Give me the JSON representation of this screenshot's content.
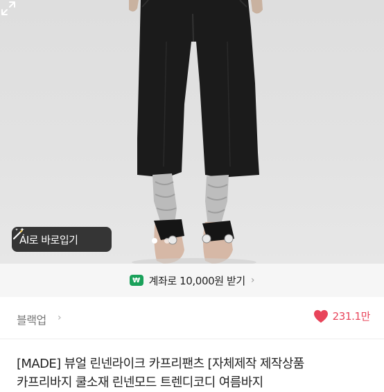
{
  "product_image": {
    "ai_button_label": "AI로 바로입기",
    "carousel_dot_count": 2,
    "carousel_active_index": 0
  },
  "account_banner": {
    "icon_text": "₩",
    "text": "계좌로 10,000원 받기"
  },
  "shop": {
    "name": "블랙업",
    "likes": "231.1만",
    "like_color": "#e8445a"
  },
  "product": {
    "title_line1": "[MADE] 뷰얼 린넨라이크 카프리팬츠 [자체제작 제작상품",
    "title_line2": "카프리바지 쿨소재 린넨모드 트렌디코디 여름바지"
  }
}
